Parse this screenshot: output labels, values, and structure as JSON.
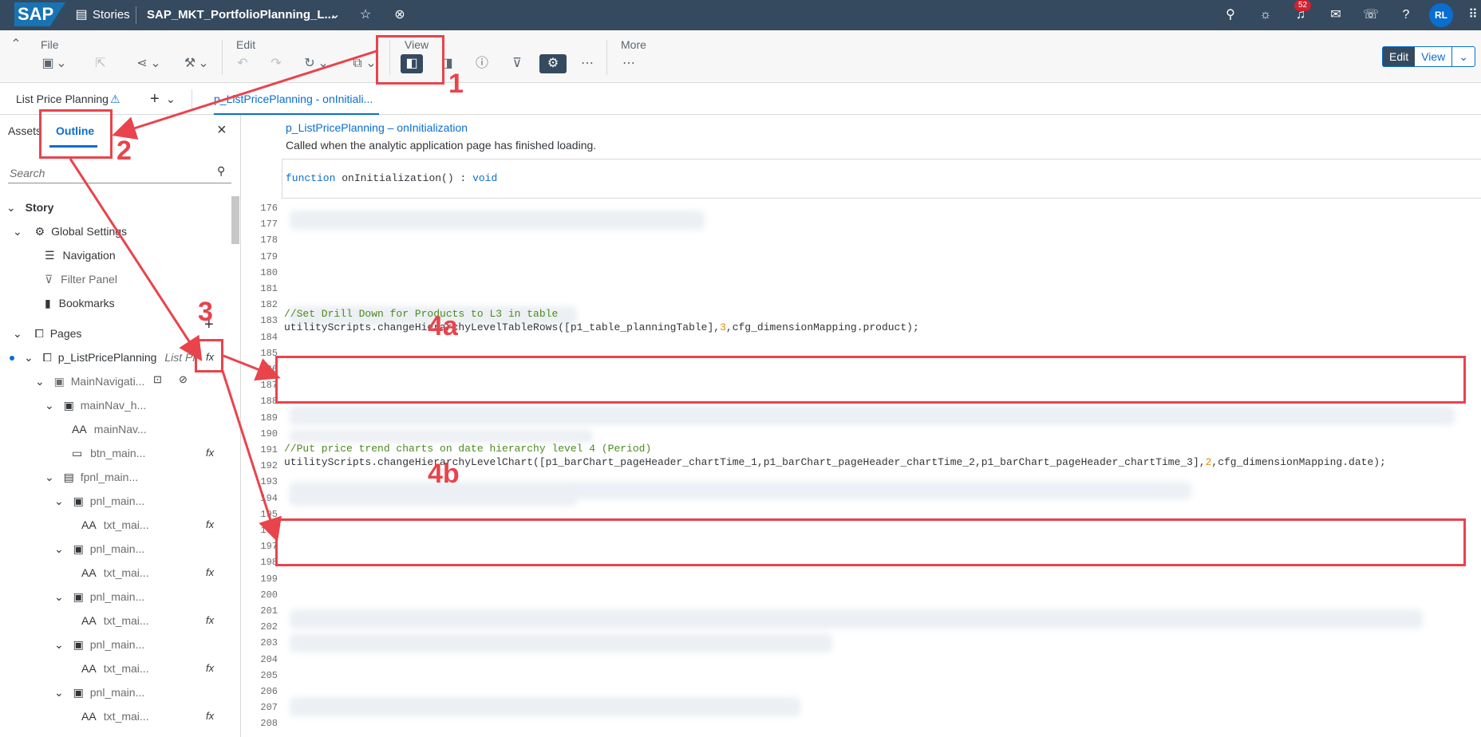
{
  "shell": {
    "brand": "SAP",
    "stories_label": "Stories",
    "story_title": "SAP_MKT_PortfolioPlanning_L...",
    "notification_count": "52",
    "avatar_initials": "RL"
  },
  "toolbar": {
    "file_label": "File",
    "edit_label": "Edit",
    "view_label": "View",
    "more_label": "More",
    "mode_edit": "Edit",
    "mode_view": "View"
  },
  "tabs": {
    "page_tab": "List Price Planning",
    "script_tab": "p_ListPricePlanning - onInitiali..."
  },
  "sidebar": {
    "assets_tab": "Assets",
    "outline_tab": "Outline",
    "search_placeholder": "Search",
    "story_label": "Story",
    "global_settings": "Global Settings",
    "navigation": "Navigation",
    "filter_panel": "Filter Panel",
    "bookmarks": "Bookmarks",
    "pages": "Pages",
    "page_name": "p_ListPricePlanning",
    "page_hint": "List Pr",
    "items": [
      {
        "label": "MainNavigati..."
      },
      {
        "label": "mainNav_h..."
      },
      {
        "label": "mainNav..."
      },
      {
        "label": "btn_main..."
      },
      {
        "label": "fpnl_main..."
      },
      {
        "label": "pnl_main..."
      },
      {
        "label": "txt_mai..."
      },
      {
        "label": "pnl_main..."
      },
      {
        "label": "txt_mai..."
      },
      {
        "label": "pnl_main..."
      },
      {
        "label": "txt_mai..."
      },
      {
        "label": "pnl_main..."
      },
      {
        "label": "txt_mai..."
      },
      {
        "label": "pnl_main..."
      },
      {
        "label": "txt_mai..."
      }
    ]
  },
  "editor": {
    "function_title": "p_ListPricePlanning – onInitialization",
    "function_desc": "Called when the analytic application page has finished loading.",
    "sig_kw": "function",
    "sig_name": " onInitialization() : ",
    "sig_type": "void",
    "code_4a_comment": "//Set Drill Down for Products to L3 in table",
    "code_4a_pre": "utilityScripts.changeHierarchyLevelTableRows([p1_table_planningTable],",
    "code_4a_num": "3",
    "code_4a_post": ",cfg_dimensionMapping.product);",
    "code_4b_comment": "//Put price trend charts on date hierarchy level 4 (Period)",
    "code_4b_pre": "utilityScripts.changeHierarchyLevelChart([p1_barChart_pageHeader_chartTime_1,p1_barChart_pageHeader_chartTime_2,p1_barChart_pageHeader_chartTime_3],",
    "code_4b_num": "2",
    "code_4b_post": ",cfg_dimensionMapping.date);",
    "line_numbers": [
      "176",
      "177",
      "178",
      "179",
      "180",
      "181",
      "182",
      "183",
      "184",
      "185",
      "186",
      "187",
      "188",
      "189",
      "190",
      "191",
      "192",
      "193",
      "194",
      "195",
      "196",
      "197",
      "198",
      "199",
      "200",
      "201",
      "202",
      "203",
      "204",
      "205",
      "206",
      "207",
      "208"
    ]
  },
  "annotations": {
    "a1": "1",
    "a2": "2",
    "a3": "3",
    "a4a": "4a",
    "a4b": "4b"
  }
}
